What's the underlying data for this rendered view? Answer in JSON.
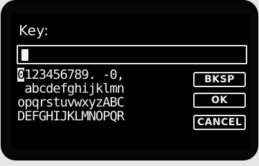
{
  "title": "Key:",
  "input": {
    "value": ""
  },
  "keyboard": {
    "rows": [
      "0123456789. -0,",
      " abcdefghijklmn",
      "opqrstuvwxyzABC",
      "DEFGHIJKLMNOPQR"
    ],
    "selected_key": "0"
  },
  "buttons": {
    "backspace": "BKSP",
    "ok": "OK",
    "cancel": "CANCEL"
  }
}
